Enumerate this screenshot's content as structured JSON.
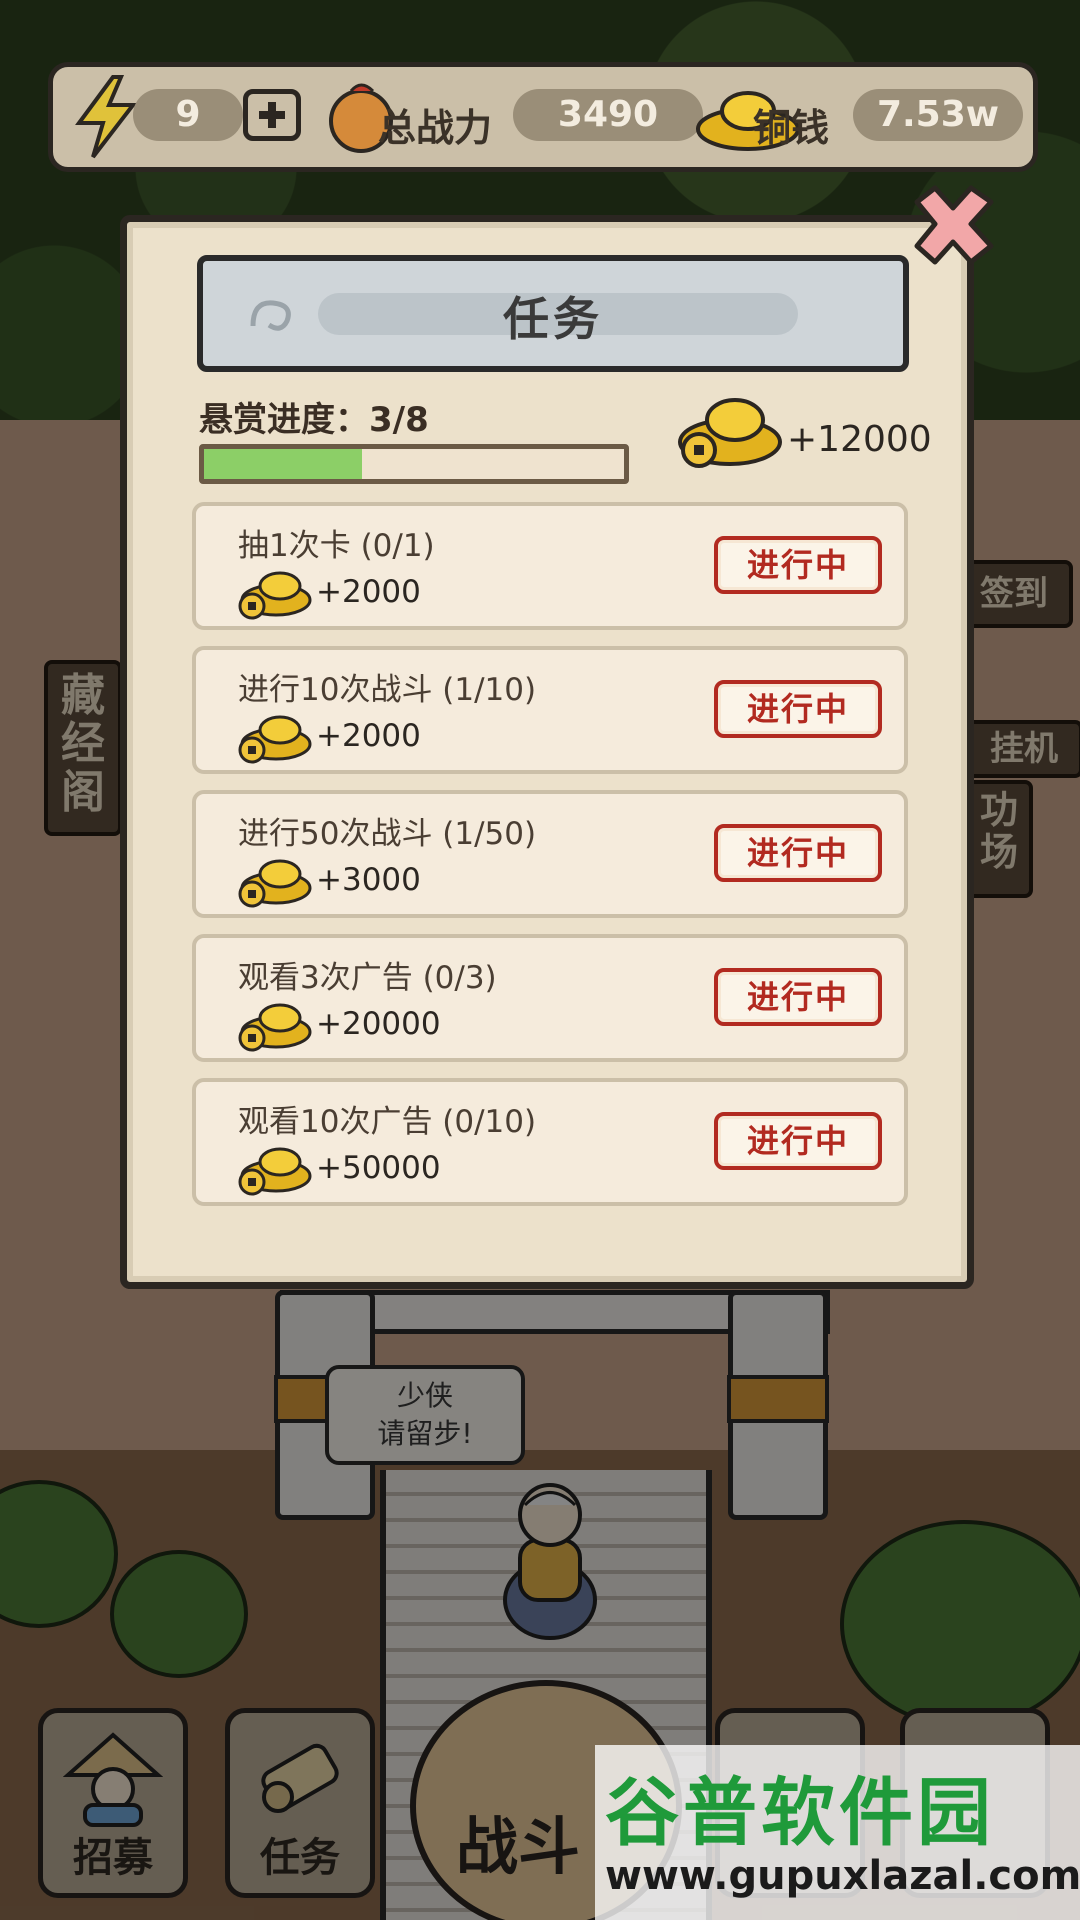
{
  "topbar": {
    "energy": "9",
    "power_label": "总战力",
    "power_value": "3490",
    "coin_label": "铜钱",
    "coin_value": "7.53w"
  },
  "side": {
    "sign_left": "藏经阁",
    "sign_right_top": "签到",
    "sign_right_mid": "挂机",
    "sign_right_bottom": "功场"
  },
  "dialog": {
    "title": "任务",
    "progress_label": "悬赏进度：3/8",
    "progress_fraction": 0.375,
    "reward_total": "+12000",
    "tasks": [
      {
        "title": "抽1次卡 (0/1)",
        "reward": "+2000",
        "status": "进行中"
      },
      {
        "title": "进行10次战斗 (1/10)",
        "reward": "+2000",
        "status": "进行中"
      },
      {
        "title": "进行50次战斗 (1/50)",
        "reward": "+3000",
        "status": "进行中"
      },
      {
        "title": "观看3次广告 (0/3)",
        "reward": "+20000",
        "status": "进行中"
      },
      {
        "title": "观看10次广告 (0/10)",
        "reward": "+50000",
        "status": "进行中"
      }
    ]
  },
  "scene": {
    "speech_line1": "少侠",
    "speech_line2": "请留步!"
  },
  "bottom": {
    "recruit_label": "招募",
    "task_label": "任务",
    "fight_label": "战斗"
  },
  "watermark": {
    "title": "谷普软件园",
    "url": "www.gupuxlazal.com"
  },
  "colors": {
    "progress_fill": "#8ccf67",
    "status_red": "#b22a20",
    "watermark_green": "#1f9a3a"
  }
}
